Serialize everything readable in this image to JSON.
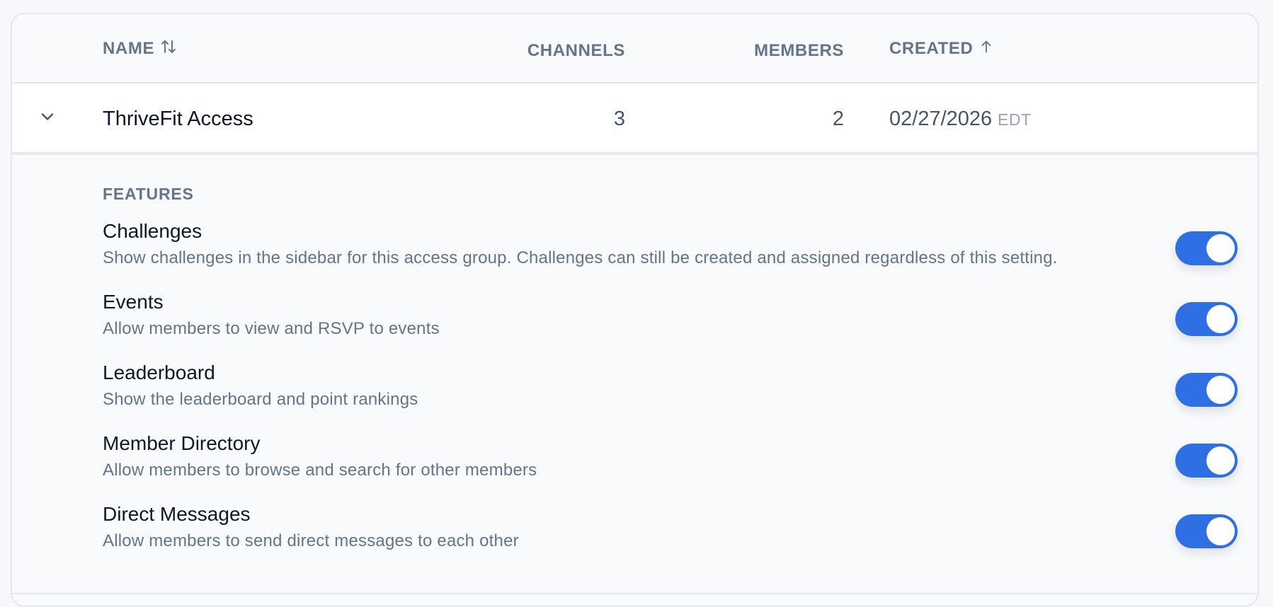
{
  "table": {
    "headers": {
      "name": "NAME",
      "channels": "CHANNELS",
      "members": "MEMBERS",
      "created": "CREATED"
    },
    "sort_icons": {
      "name": "sort-toggle-icon",
      "created": "arrow-up-icon"
    },
    "rows": [
      {
        "name": "ThriveFit Access",
        "channels": "3",
        "members": "2",
        "created_date": "02/27/2026",
        "created_tz": "EDT",
        "expanded": true
      }
    ]
  },
  "features": {
    "heading": "FEATURES",
    "accent_color": "#2f6fe4",
    "items": [
      {
        "title": "Challenges",
        "description": "Show challenges in the sidebar for this access group. Challenges can still be created and assigned regardless of this setting.",
        "enabled": true
      },
      {
        "title": "Events",
        "description": "Allow members to view and RSVP to events",
        "enabled": true
      },
      {
        "title": "Leaderboard",
        "description": "Show the leaderboard and point rankings",
        "enabled": true
      },
      {
        "title": "Member Directory",
        "description": "Allow members to browse and search for other members",
        "enabled": true
      },
      {
        "title": "Direct Messages",
        "description": "Allow members to send direct messages to each other",
        "enabled": true
      }
    ]
  }
}
